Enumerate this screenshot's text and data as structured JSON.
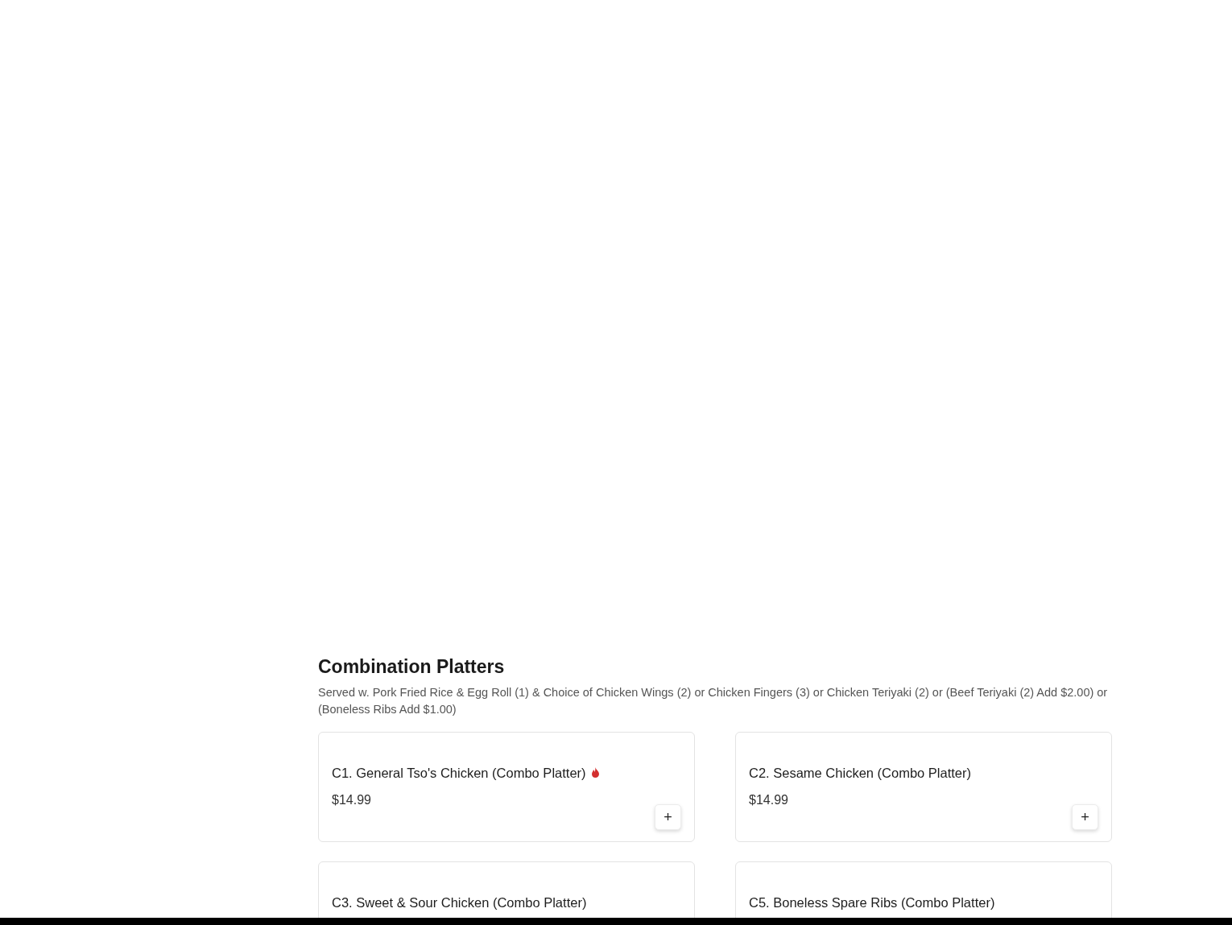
{
  "section": {
    "title": "Combination Platters",
    "description": "Served w. Pork Fried Rice & Egg Roll (1) & Choice of Chicken Wings (2) or Chicken Fingers (3) or Chicken Teriyaki (2) or (Beef Teriyaki (2) Add $2.00) or (Boneless Ribs Add $1.00)",
    "items": [
      {
        "name": "C1. General Tso's Chicken (Combo Platter)",
        "spicy": true,
        "price": "$14.99",
        "add_label": "+"
      },
      {
        "name": "C2. Sesame Chicken (Combo Platter)",
        "spicy": false,
        "price": "$14.99",
        "add_label": "+"
      },
      {
        "name": "C3. Sweet & Sour Chicken (Combo Platter)",
        "spicy": false
      },
      {
        "name": "C5. Boneless Spare Ribs (Combo Platter)",
        "spicy": false
      }
    ]
  }
}
